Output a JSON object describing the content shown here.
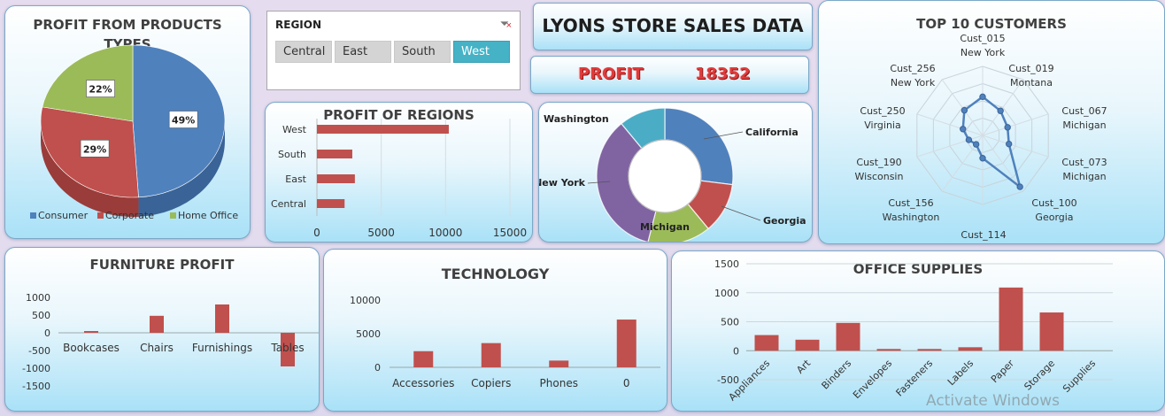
{
  "dashboard": {
    "title": "LYONS STORE SALES DATA",
    "profit_label": "PROFIT",
    "profit_value": "18352",
    "watermark": "Activate Windows"
  },
  "slicer": {
    "title": "REGION",
    "items": [
      "Central",
      "East",
      "South",
      "West"
    ],
    "selected": "West"
  },
  "colors": {
    "bar": "#c0504d",
    "blue": "#4f81bd",
    "red": "#c0504d",
    "green": "#9bbb59",
    "purple": "#8064a2",
    "teal": "#4bacc6",
    "selected": "#45b2c6"
  },
  "chart_data": [
    {
      "id": "product_types",
      "type": "pie",
      "title": "PROFIT FROM PRODUCTS TYPES",
      "title_lines": [
        "PROFIT FROM PRODUCTS",
        "TYPES"
      ],
      "labels": [
        "Consumer",
        "Corporate",
        "Home Office"
      ],
      "values": [
        49,
        29,
        22
      ],
      "data_labels": [
        "49%",
        "29%",
        "22%"
      ],
      "legend": "bottom"
    },
    {
      "id": "regions",
      "type": "bar",
      "orientation": "horizontal",
      "title": "PROFIT OF REGIONS",
      "categories": [
        "West",
        "South",
        "East",
        "Central"
      ],
      "values": [
        10250,
        2750,
        2950,
        2150
      ],
      "xlim": [
        0,
        15000
      ],
      "x_ticks": [
        "0",
        "5000",
        "10000",
        "15000"
      ],
      "grid": true
    },
    {
      "id": "states",
      "type": "pie",
      "subtype": "donut",
      "labels": [
        "California",
        "Georgia",
        "Michigan",
        "New York",
        "Washington"
      ],
      "values": [
        27,
        12,
        15,
        35,
        11
      ]
    },
    {
      "id": "top_customers",
      "type": "radar",
      "title": "TOP 10 CUSTOMERS",
      "categories": [
        "Cust_015\nNew York",
        "Cust_019\nMontana",
        "Cust_067\nMichigan",
        "Cust_073\nMichigan",
        "Cust_100\nGeorgia",
        "Cust_114",
        "Cust_156\nWashington",
        "Cust_190\nWisconsin",
        "Cust_250\nVirginia",
        "Cust_256\nNew York"
      ],
      "values": [
        0.56,
        0.44,
        0.38,
        0.4,
        0.92,
        0.33,
        0.16,
        0.21,
        0.3,
        0.45
      ]
    },
    {
      "id": "furniture",
      "type": "bar",
      "title": "FURNITURE PROFIT",
      "categories": [
        "Bookcases",
        "Chairs",
        "Furnishings",
        "Tables"
      ],
      "values": [
        50,
        480,
        800,
        -950
      ],
      "ylim": [
        -1500,
        1000
      ],
      "y_ticks": [
        "1000",
        "500",
        "0",
        "-500",
        "-1000",
        "-1500"
      ]
    },
    {
      "id": "technology",
      "type": "bar",
      "title": "TECHNOLOGY",
      "categories": [
        "Accessories",
        "Copiers",
        "Phones",
        "0"
      ],
      "values": [
        2400,
        3600,
        1000,
        7100
      ],
      "ylim": [
        0,
        10000
      ],
      "y_ticks": [
        "10000",
        "5000",
        "0"
      ]
    },
    {
      "id": "office_supplies",
      "type": "bar",
      "title": "OFFICE SUPPLIES",
      "categories": [
        "Appliances",
        "Art",
        "Binders",
        "Envelopes",
        "Fasteners",
        "Labels",
        "Paper",
        "Storage",
        "Supplies"
      ],
      "values": [
        270,
        190,
        480,
        30,
        30,
        60,
        1090,
        660,
        0
      ],
      "ylim": [
        -500,
        1500
      ],
      "y_ticks": [
        "1500",
        "1000",
        "500",
        "0",
        "-500"
      ],
      "grid": true
    }
  ]
}
